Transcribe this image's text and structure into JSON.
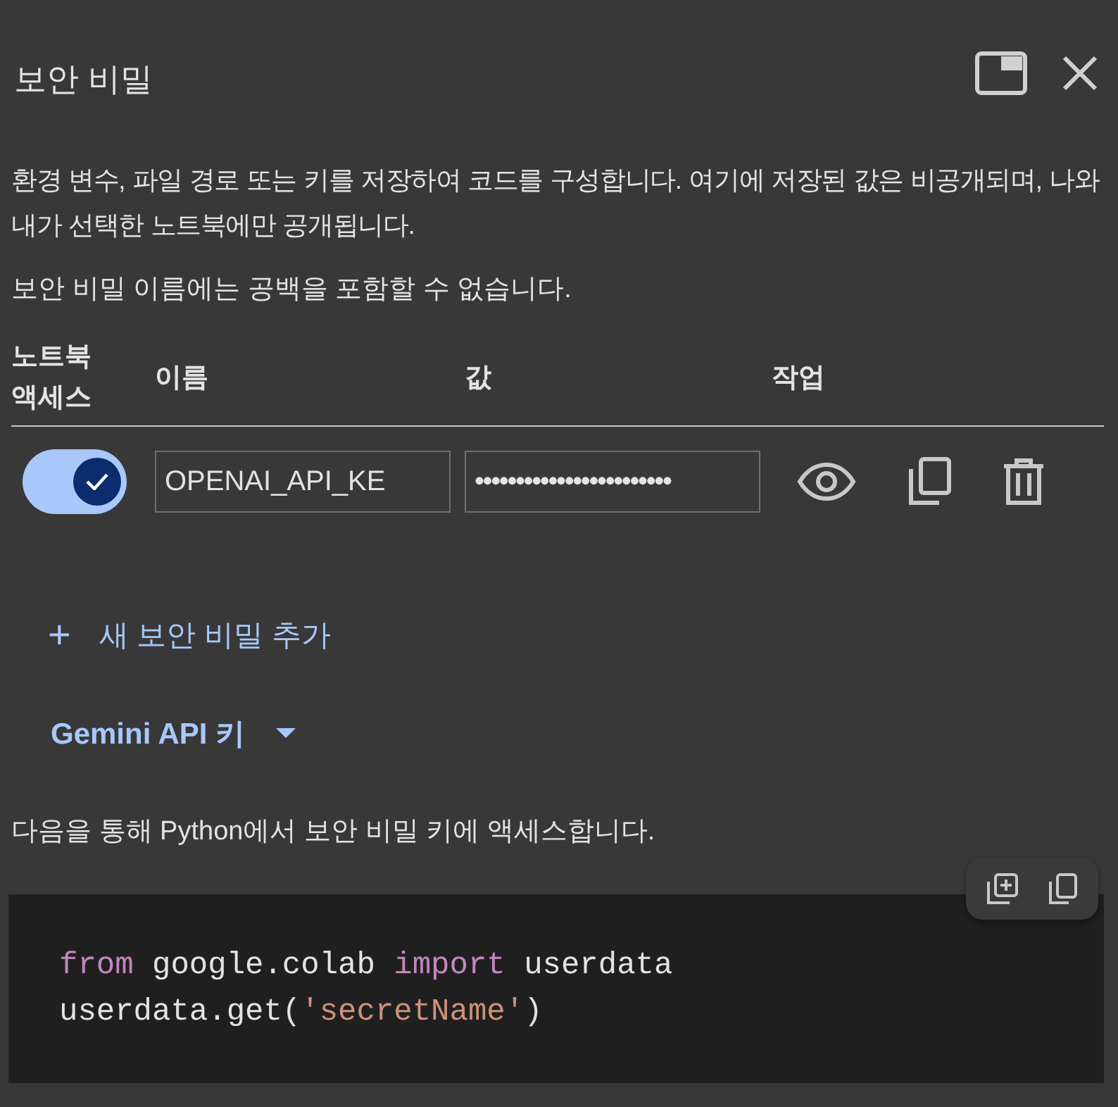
{
  "panel": {
    "title": "보안 비밀"
  },
  "description": "환경 변수, 파일 경로 또는 키를 저장하여 코드를 구성합니다. 여기에 저장된 값은 비공개되며, 나와 내가 선택한 노트북에만 공개됩니다.",
  "note": "보안 비밀 이름에는 공백을 포함할 수 없습니다.",
  "table": {
    "columns": [
      "노트북\n액세스",
      "이름",
      "값",
      "작업"
    ],
    "rows": [
      {
        "notebook_access": true,
        "name": "OPENAI_API_KE",
        "value": "••••••••••••••••••••••••"
      }
    ]
  },
  "add_button": {
    "icon": "+",
    "label": "새 보안 비밀 추가"
  },
  "dropdown": {
    "label": "Gemini API 키"
  },
  "access_text": "다음을 통해 Python에서 보안 비밀 키에 액세스합니다.",
  "code": [
    [
      {
        "kind": "keyword",
        "text": "from"
      },
      {
        "kind": "plain",
        "text": " google.colab "
      },
      {
        "kind": "keyword",
        "text": "import"
      },
      {
        "kind": "plain",
        "text": " userdata"
      }
    ],
    [
      {
        "kind": "plain",
        "text": "userdata.get("
      },
      {
        "kind": "string",
        "text": "'secretName'"
      },
      {
        "kind": "plain",
        "text": ")"
      }
    ]
  ]
}
